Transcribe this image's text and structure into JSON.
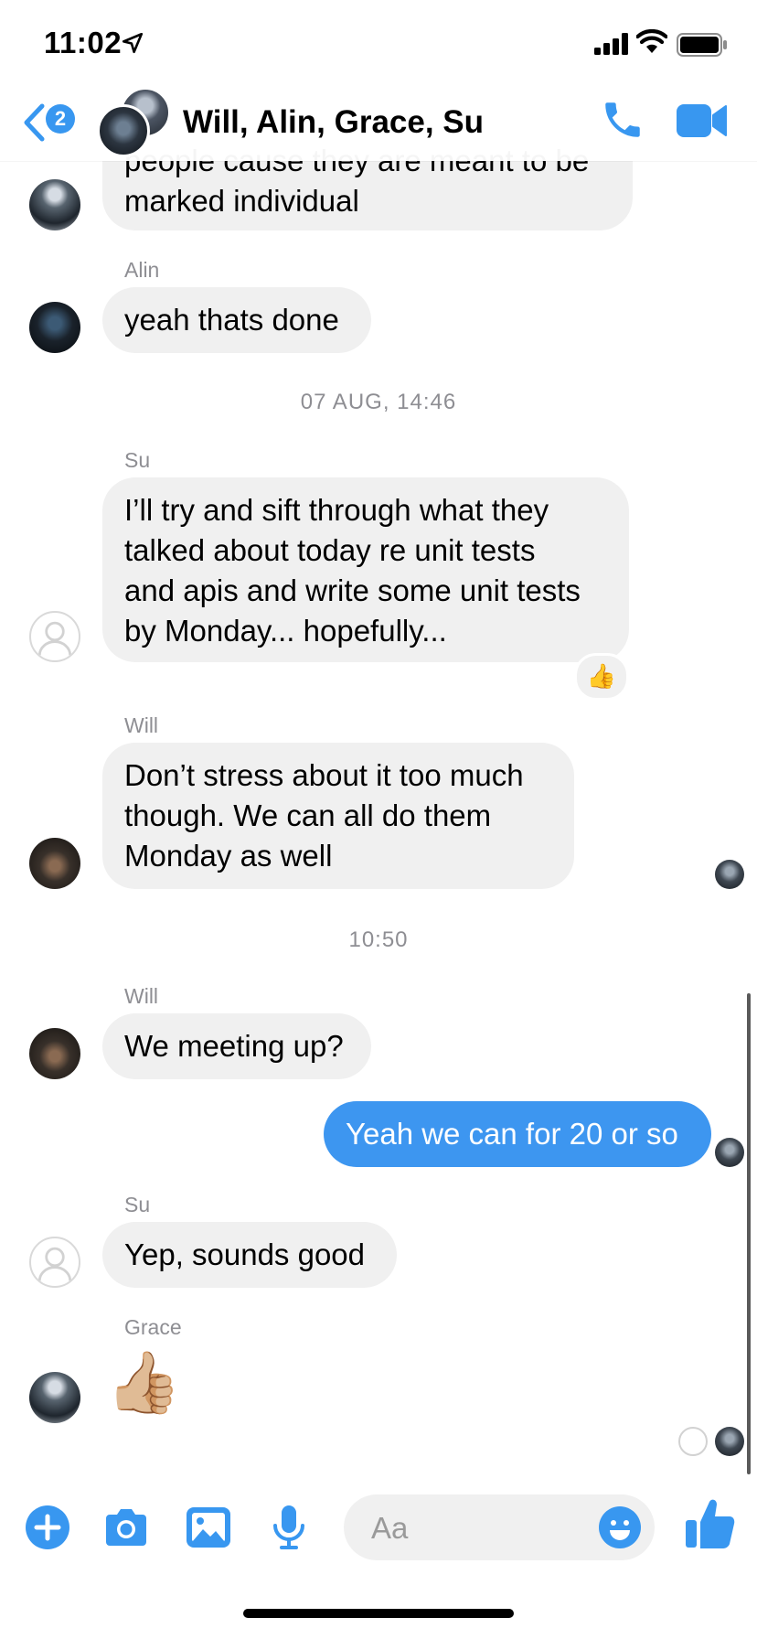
{
  "status_bar": {
    "time": "11:02"
  },
  "header": {
    "back_badge": "2",
    "title": "Will, Alin, Grace, Su"
  },
  "messages": {
    "m1": {
      "lines": [
        "people cause they are meant to be",
        "marked individual"
      ]
    },
    "m2": {
      "sender": "Alin",
      "lines": [
        "yeah thats done"
      ]
    },
    "ts1": "07 AUG, 14:46",
    "m3": {
      "sender": "Su",
      "lines": [
        "I’ll try and sift through what they",
        "talked about today re unit tests",
        "and apis and write some unit tests",
        "by Monday... hopefully..."
      ],
      "reaction": "👍"
    },
    "m4": {
      "sender": "Will",
      "lines": [
        "Don’t stress about it too much",
        "though. We can all do them",
        "Monday as well"
      ]
    },
    "ts2": "10:50",
    "m5": {
      "sender": "Will",
      "lines": [
        "We meeting up?"
      ]
    },
    "m6": {
      "lines": [
        "Yeah we can for 20 or so"
      ]
    },
    "m7": {
      "sender": "Su",
      "lines": [
        "Yep, sounds good"
      ]
    },
    "m8": {
      "sender": "Grace",
      "emoji": "👍🏼"
    }
  },
  "composer": {
    "placeholder": "Aa"
  },
  "colors": {
    "accent": "#3897f0",
    "my_bubble": "#3d96f0",
    "their_bubble": "#f0f0f0"
  },
  "icons": [
    "back-chevron-icon",
    "phone-icon",
    "video-camera-icon",
    "plus-icon",
    "camera-icon",
    "photo-gallery-icon",
    "microphone-icon",
    "emoji-icon",
    "thumbs-up-icon"
  ]
}
